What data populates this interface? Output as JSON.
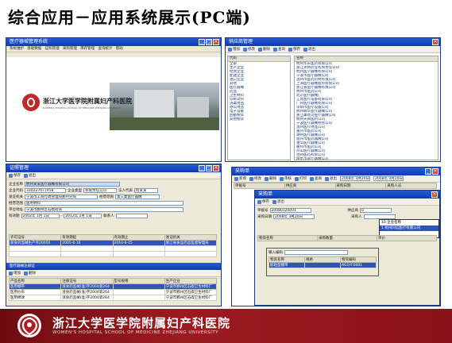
{
  "slide": {
    "title": "综合应用－应用系统展示(PC端)",
    "banner_cn": "浙江大学医学院附属妇产科医院",
    "banner_en": "WOMEN'S HOSPITAL SCHOOL OF MEDICINE ZHEJIANG UNIVERSITY"
  },
  "win_main": {
    "title": "医疗器械管理系统",
    "menu": [
      "系统维护",
      "基础数据",
      "证照管理",
      "采购管理",
      "库存管理",
      "查询统计",
      "帮助"
    ],
    "logo_cn": "浙江大学医学院附属妇产科医院",
    "logo_en": "WOMEN'S HOSPITAL SCHOOL OF MEDICINE ZHEJIANG UNIVERSITY"
  },
  "win_supplier": {
    "title": "供应商管理",
    "toolbar": [
      "增加",
      "修改",
      "删除",
      "查询",
      "保存",
      "退出"
    ],
    "tabs": [
      "代码",
      "名称"
    ],
    "left_items": [
      "全部",
      "生产企业",
      "经营企业",
      "配送企业",
      "进口企业",
      "其他",
      "医疗器械",
      "药品",
      "卫生材料",
      "诊断试剂",
      "消毒用品",
      "办公用品",
      "电子设备",
      "后勤物资",
      "其他物资"
    ],
    "right_items": [
      "杭州华东医药有限公司",
      "浙江英特药业有限责任公司",
      "杭州医学器械有限公司",
      "宁波市医疗器械公司",
      "温州市医药药材有限公司",
      "上海医疗器械股份有限公司",
      "浙江省医疗器械有限公司",
      "杭州市医药公司",
      "北京医疗器械厂",
      "江苏医疗设备有限公司",
      "广州医疗器械有限公司",
      "深圳市医疗设备公司",
      "杭州联华医疗器械公司",
      "浙江康恩贝医疗器械公司",
      "杭州天目医药公司",
      "宁波医疗器械经营公司",
      "温州医疗用品公司",
      "嘉兴市医药公司",
      "湖州医疗器械公司",
      "绍兴市医药器械公司",
      "金华医疗器械公司",
      "衢州市医药公司",
      "舟山医疗器械公司",
      "台州医药有限公司",
      "丽水市医疗器械公司"
    ]
  },
  "win_cert": {
    "title": "证照管理",
    "toolbar": [
      "保存",
      "退出"
    ],
    "fields": {
      "company_label": "企业名称",
      "company_value": "杭州某某医疗器械有限公司",
      "code_label": "企业代码",
      "code_value": "330227071958",
      "type_label": "企业类型",
      "type_value": "有限责任公司",
      "legal_label": "法人代表",
      "legal_value": "何某某",
      "issuer_label": "发证机关",
      "issuer_value": "宁波市工商行政管理局鄞州分局",
      "scope_label": "经营范围",
      "scope_value": "第三类医疗器械",
      "product_label": "经营范围",
      "product_value": "医用材料",
      "address_label": "单位地址",
      "address_value": "宁波市鄞州区石碶街道",
      "valid_label": "有效期",
      "valid_from": "2002年 1月 1日",
      "valid_to": "2012年 1月 1日",
      "contact_label": "联系人"
    },
    "license_table": {
      "headers": [
        "许可证号",
        "有效期起",
        "有效期止",
        "发证机关"
      ],
      "rows": [
        [
          "浙食药监械生产许20050",
          "2005-6-16",
          "2010-6-15",
          "浙江省食品药品监督管理局"
        ]
      ]
    },
    "tabs2": [
      "医疗器械注册证",
      "医疗器械经营许可证"
    ],
    "product_table": {
      "headers": [
        "产品名称",
        "注册证号",
        "型号规格",
        "生产企业"
      ],
      "rows": [
        [
          "医用绷带",
          "浙食药监械(准)字2004第264",
          "",
          "宁波市鄞州区石碶卫生材料厂"
        ],
        [
          "医用纱布",
          "浙食药监械(准)字2004第264",
          "",
          "宁波市鄞州区石碶卫生材料厂"
        ],
        [
          "医用棉球",
          "浙食药监械(准)字2004第264",
          "",
          "宁波市鄞州区石碶卫生材料厂"
        ]
      ]
    }
  },
  "win_order": {
    "title": "采购单",
    "toolbar": [
      "新增",
      "修改",
      "删除",
      "审核",
      "打印",
      "查询",
      "退出"
    ],
    "date_from": "2008年 3月20日",
    "date_to": "2008年 3月20日",
    "headers": [
      "单据号",
      "供应商",
      "采购日期",
      "采购人员"
    ],
    "inner": {
      "title": "采购单",
      "toolbar": [
        "保存",
        "退出"
      ],
      "no_label": "单据号",
      "no_value": "20080320001",
      "date_label": "采购日期",
      "date_value": "2008年 3月20日",
      "supplier_label": "供应商",
      "supplier_value": "0",
      "buyer_label": "采购人",
      "headers": [
        "物资名称",
        "采购数量",
        "单价"
      ],
      "dropdown": [
        "10  企业名称",
        "1   杭州同信医疗有限公司"
      ],
      "input_label": "输入编码",
      "sub_headers": [
        "物资名称",
        "规格",
        "物资编码"
      ],
      "sub_rows": [
        [
          "胶粘型绷带",
          "",
          "AG1YF0001"
        ]
      ]
    }
  }
}
